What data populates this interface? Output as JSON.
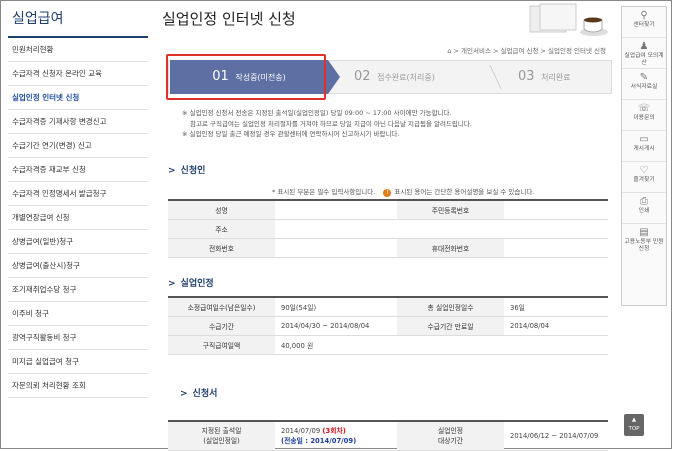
{
  "sidebar": {
    "title": "실업급여",
    "items": [
      {
        "label": "민원처리현황"
      },
      {
        "label": "수급자격 신청자 온라인 교육"
      },
      {
        "label": "실업인정 인터넷 신청"
      },
      {
        "label": "수급자격증 기재사항 변경신고"
      },
      {
        "label": "수급기간 연기(변경) 신고"
      },
      {
        "label": "수급자격증 재교부 신청"
      },
      {
        "label": "수급자격 인정명세서 발급청구"
      },
      {
        "label": "개별연장급여 신청"
      },
      {
        "label": "상병급여(일반)청구"
      },
      {
        "label": "상병급여(출산시)청구"
      },
      {
        "label": "조기재취업수당 청구"
      },
      {
        "label": "이주비 청구"
      },
      {
        "label": "광역구직활동비 청구"
      },
      {
        "label": "미지급 실업급여 청구"
      },
      {
        "label": "자문의뢰 처리현황 조회"
      }
    ]
  },
  "main": {
    "title": "실업인정 인터넷 신청",
    "breadcrumb": "⌂ > 개인서비스 > 실업급여 신청 > 실업인정 인터넷 신청",
    "steps": [
      {
        "num": "01",
        "label": "작성중(미전송)"
      },
      {
        "num": "02",
        "label": "접수완료(처리중)"
      },
      {
        "num": "03",
        "label": "처리완료"
      }
    ],
    "notes": [
      "※ 실업인정 신청서 전송은 지정된 출석일(실업인정일) 당일 09:00 ~ 17:00 사이에만 가능합니다.",
      "참고로 구직급여는 실업인정 처리절차를 거쳐야 하므로 당일 지급이 아닌 다음날 지급됨을 알려드립니다.",
      "※ 실업인정 당일 출근 예정일 경우 관할센터에 연락하시어 신고하시기 바랍니다."
    ],
    "applicant_section": {
      "title": "신청인",
      "legend_required": "* 표시된 부분은 필수 입력사항입니다.",
      "legend_help": "표시된 용어는 간단한 용어설명을 보실 수 있습니다.",
      "labels": {
        "name": "성명",
        "ssn": "주민등록번호",
        "address": "주소",
        "phone": "전화번호",
        "mobile": "휴대전화번호"
      }
    },
    "recognition_section": {
      "title": "실업인정",
      "rows": [
        {
          "label": "소정급여일수(남은일수)",
          "value": "90일(54일)",
          "label2": "총 실업인정일수",
          "value2": "36일"
        },
        {
          "label": "수급기간",
          "value": "2014/04/30 ~ 2014/08/04",
          "label2": "수급기간 만료일",
          "value2": "2014/08/04"
        },
        {
          "label": "구직급여일액",
          "value": "40,000 원"
        }
      ]
    },
    "application_section": {
      "title": "신청서",
      "designated_label": "지정된 출석일\n(실업인정일)",
      "designated_date": "2014/07/09",
      "designated_round": "(3회차)",
      "sent_date": "(전송일 : 2014/07/09)",
      "period_label": "실업인정\n대상기간",
      "period_value": "2014/06/12 ~ 2014/07/09"
    }
  },
  "rail": {
    "items": [
      "센터찾기",
      "실업급여 모의계산",
      "서식자료실",
      "이용문의",
      "게시게시",
      "즐겨찾기",
      "인쇄",
      "고용노동부 민원신청"
    ],
    "top_label": "TOP"
  }
}
